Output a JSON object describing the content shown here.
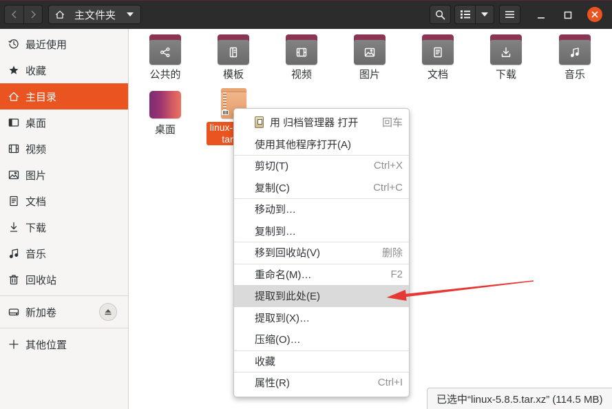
{
  "colors": {
    "accent": "#E95420",
    "header": "#2c2c2c",
    "sidebar": "#f6f5f4",
    "menu_highlight": "#dadada",
    "folder_tab": "#8b3554",
    "folder_body": "#767676",
    "annotation_arrow": "#e53935"
  },
  "header": {
    "back_icon": "chevron-left-icon",
    "forward_icon": "chevron-right-icon",
    "path_icon": "home-icon",
    "path_label": "主文件夹",
    "path_dropdown_icon": "triangle-down-icon",
    "search_icon": "search-icon",
    "view_icon": "list-view-icon",
    "view_dropdown_icon": "triangle-down-icon",
    "menu_icon": "hamburger-menu-icon",
    "window_controls": [
      "minimize-icon",
      "maximize-icon",
      "close-icon"
    ]
  },
  "sidebar": {
    "places": [
      {
        "label": "最近使用",
        "icon": "clock-icon"
      },
      {
        "label": "收藏",
        "icon": "star-icon"
      },
      {
        "label": "主目录",
        "icon": "home-icon",
        "selected": true
      },
      {
        "label": "桌面",
        "icon": "desktop-icon"
      },
      {
        "label": "视频",
        "icon": "video-icon"
      },
      {
        "label": "图片",
        "icon": "image-icon"
      },
      {
        "label": "文档",
        "icon": "document-icon"
      },
      {
        "label": "下载",
        "icon": "download-icon"
      },
      {
        "label": "音乐",
        "icon": "music-icon"
      },
      {
        "label": "回收站",
        "icon": "trash-icon"
      }
    ],
    "devices": [
      {
        "label": "新加卷",
        "icon": "drive-icon",
        "action_icon": "eject-icon"
      }
    ],
    "other": {
      "label": "其他位置",
      "icon": "plus-icon"
    }
  },
  "files": [
    {
      "name": "公共的",
      "icon": "share-folder-icon"
    },
    {
      "name": "模板",
      "icon": "templates-folder-icon"
    },
    {
      "name": "视频",
      "icon": "video-folder-icon"
    },
    {
      "name": "图片",
      "icon": "image-folder-icon"
    },
    {
      "name": "文档",
      "icon": "document-folder-icon"
    },
    {
      "name": "下载",
      "icon": "download-folder-icon"
    },
    {
      "name": "音乐",
      "icon": "music-folder-icon"
    },
    {
      "name": "桌面",
      "icon": "desktop-folder-icon"
    },
    {
      "name": "linux-5.8.5.tar.xz",
      "icon": "archive-icon",
      "selected": true
    }
  ],
  "context_menu": {
    "items": [
      {
        "label": "用 归档管理器 打开",
        "shortcut": "回车",
        "icon": "archive-manager-icon"
      },
      {
        "label": "使用其他程序打开(A)"
      },
      {
        "label": "剪切(T)",
        "shortcut": "Ctrl+X"
      },
      {
        "label": "复制(C)",
        "shortcut": "Ctrl+C"
      },
      {
        "label": "移动到…"
      },
      {
        "label": "复制到…"
      },
      {
        "label": "移到回收站(V)",
        "shortcut": "删除"
      },
      {
        "label": "重命名(M)…",
        "shortcut": "F2"
      },
      {
        "label": "提取到此处(E)",
        "highlighted": true
      },
      {
        "label": "提取到(X)…"
      },
      {
        "label": "压缩(O)…"
      },
      {
        "label": "收藏"
      },
      {
        "label": "属性(R)",
        "shortcut": "Ctrl+I"
      }
    ]
  },
  "status": {
    "text": "已选中“linux-5.8.5.tar.xz” (114.5 MB)"
  }
}
